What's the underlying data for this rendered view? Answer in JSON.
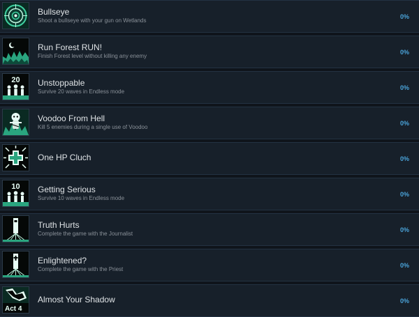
{
  "achievements": [
    {
      "title": "Bullseye",
      "description": "Shoot a bullseye with your gun on Wetlands",
      "percent": "0%",
      "icon": "target-icon"
    },
    {
      "title": "Run Forest RUN!",
      "description": "Finish Forest level without killing any enemy",
      "percent": "0%",
      "icon": "forest-moon-icon"
    },
    {
      "title": "Unstoppable",
      "description": "Survive 20 waves in Endless mode",
      "percent": "0%",
      "icon": "wave-20-icon",
      "icon_text": "20"
    },
    {
      "title": "Voodoo From Hell",
      "description": "Kill 5 enemies during a single use of Voodoo",
      "percent": "0%",
      "icon": "voodoo-icon"
    },
    {
      "title": "One HP Cluch",
      "description": "",
      "percent": "0%",
      "icon": "health-cross-icon"
    },
    {
      "title": "Getting Serious",
      "description": "Survive 10 waves in Endless mode",
      "percent": "0%",
      "icon": "wave-10-icon",
      "icon_text": "10"
    },
    {
      "title": "Truth Hurts",
      "description": "Complete the game with the Journalist",
      "percent": "0%",
      "icon": "journalist-icon"
    },
    {
      "title": "Enlightened?",
      "description": "Complete the game with the Priest",
      "percent": "0%",
      "icon": "priest-icon"
    },
    {
      "title": "Almost Your Shadow",
      "description": "",
      "percent": "0%",
      "icon": "act-4-icon",
      "icon_text": "Act 4"
    }
  ],
  "colors": {
    "background": "#0f141b",
    "row": "#17202a",
    "accent_green": "#3fd0a0",
    "percent_blue": "#4aa3d9"
  }
}
